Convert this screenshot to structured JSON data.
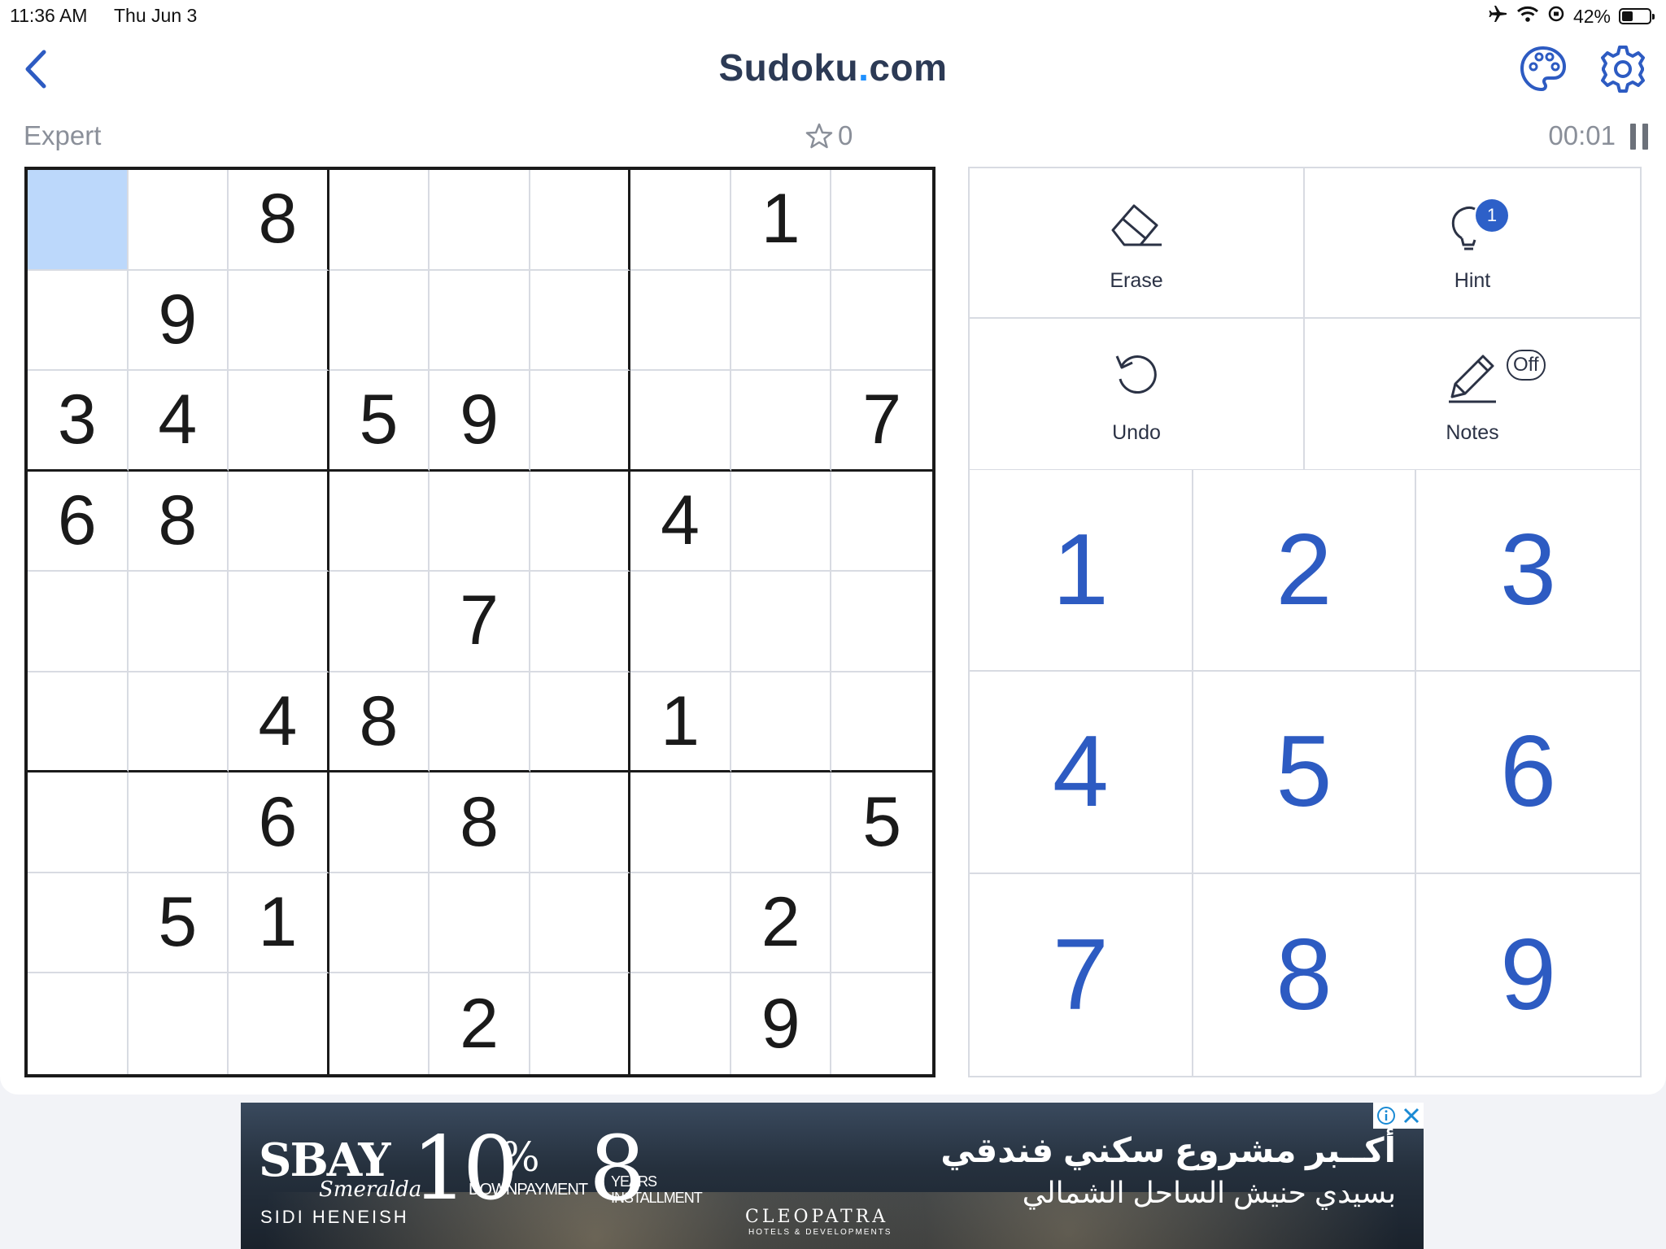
{
  "status_bar": {
    "time": "11:36 AM",
    "date": "Thu Jun 3",
    "battery": "42%",
    "battery_level": 0.42
  },
  "header": {
    "title_main": "Sudoku",
    "title_dot": ".",
    "title_tld": "com"
  },
  "info": {
    "difficulty": "Expert",
    "score": "0",
    "timer": "00:01"
  },
  "board": {
    "selected": [
      0,
      0
    ],
    "rows": [
      [
        "",
        "",
        "8",
        "",
        "",
        "",
        "",
        "1",
        ""
      ],
      [
        "",
        "9",
        "",
        "",
        "",
        "",
        "",
        "",
        ""
      ],
      [
        "3",
        "4",
        "",
        "5",
        "9",
        "",
        "",
        "",
        "7"
      ],
      [
        "6",
        "8",
        "",
        "",
        "",
        "",
        "4",
        "",
        ""
      ],
      [
        "",
        "",
        "",
        "",
        "7",
        "",
        "",
        "",
        ""
      ],
      [
        "",
        "",
        "4",
        "8",
        "",
        "",
        "1",
        "",
        ""
      ],
      [
        "",
        "",
        "6",
        "",
        "8",
        "",
        "",
        "",
        "5"
      ],
      [
        "",
        "5",
        "1",
        "",
        "",
        "",
        "",
        "2",
        ""
      ],
      [
        "",
        "",
        "",
        "",
        "2",
        "",
        "",
        "9",
        ""
      ]
    ]
  },
  "tools": {
    "erase": "Erase",
    "hint": "Hint",
    "hint_count": "1",
    "undo": "Undo",
    "notes": "Notes",
    "notes_state": "Off"
  },
  "numpad": [
    "1",
    "2",
    "3",
    "4",
    "5",
    "6",
    "7",
    "8",
    "9"
  ],
  "colors": {
    "accent": "#2d5bc2",
    "selected_cell": "#bcd8fb",
    "title": "#2c3a55"
  },
  "ad": {
    "brand": "SBAY",
    "brand_sub": "Smeralda",
    "location": "SIDI HENEISH",
    "percent": "10",
    "percent_sign": "%",
    "down_payment": "DOWNPAYMENT",
    "years": "8",
    "years_label": "YEARS INSTALLMENT",
    "developer": "CLEOPATRA",
    "developer_sub": "HOTELS & DEVELOPMENTS",
    "arabic_line1": "أكــبر مشروع سكني فندقي",
    "arabic_line2": "بسيدي حنيش الساحل الشمالي"
  }
}
